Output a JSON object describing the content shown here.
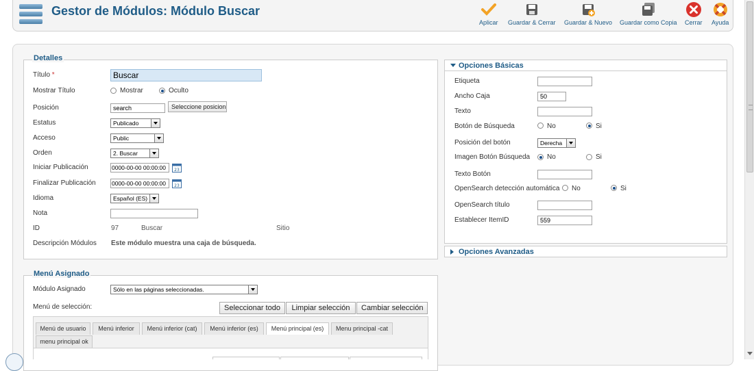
{
  "header": {
    "title": "Gestor de Módulos: Módulo Buscar",
    "toolbar": [
      {
        "label": "Aplicar",
        "icon": "checkmark-icon"
      },
      {
        "label": "Guardar & Cerrar",
        "icon": "save-icon"
      },
      {
        "label": "Guardar & Nuevo",
        "icon": "save-new-icon"
      },
      {
        "label": "Guardar como Copia",
        "icon": "save-copy-icon"
      },
      {
        "label": "Cerrar",
        "icon": "close-icon"
      },
      {
        "label": "Ayuda",
        "icon": "help-lifebuoy-icon"
      }
    ]
  },
  "details": {
    "legend": "Detalles",
    "title_label": "Título",
    "required_mark": "*",
    "title_value": "Buscar",
    "show_title_label": "Mostrar Título",
    "show_option": "Mostrar",
    "hide_option": "Oculto",
    "show_title_selected": "Oculto",
    "position_label": "Posición",
    "position_value": "search",
    "select_position_button": "Seleccione posicion",
    "status_label": "Estatus",
    "status_value": "Publicado",
    "access_label": "Acceso",
    "access_value": "Public",
    "order_label": "Orden",
    "order_value": "2. Buscar",
    "start_label": "Iniciar Publicación",
    "start_value": "0000-00-00 00:00:00",
    "finish_label": "Finalizar Publicación",
    "finish_value": "0000-00-00 00:00:00",
    "language_label": "Idioma",
    "language_value": "Español (ES)",
    "note_label": "Nota",
    "note_value": "",
    "id_label": "ID",
    "id_value": "97",
    "module_name": "Buscar",
    "site": "Sitio",
    "desc_label": "Descripción Módulos",
    "desc_value": "Este módulo muestra una caja de búsqueda."
  },
  "basic_options": {
    "title": "Opciones Básicas",
    "label_label": "Etiqueta",
    "label_value": "",
    "box_width_label": "Ancho Caja",
    "box_width_value": "50",
    "text_label": "Texto",
    "text_value": "",
    "search_button_label": "Botón de Búsqueda",
    "search_button_selected": "Si",
    "button_position_label": "Posición del botón",
    "button_position_value": "Derecha",
    "image_button_label": "Imagen Botón Búsqueda",
    "image_button_selected": "No",
    "button_text_label": "Texto Botón",
    "button_text_value": "",
    "opensearch_autodetect_label": "OpenSearch detección automática",
    "opensearch_autodetect_selected": "Si",
    "opensearch_title_label": "OpenSearch título",
    "opensearch_title_value": "",
    "itemid_label": "Establecer ItemID",
    "itemid_value": "559",
    "no_option": "No",
    "yes_option": "Si"
  },
  "advanced_options": {
    "title": "Opciones Avanzadas"
  },
  "menu_assignment": {
    "legend": "Menú Asignado",
    "assigned_label": "Módulo Asignado",
    "assigned_value": "Sólo en las páginas seleccionadas.",
    "selection_label": "Menú de selección:",
    "buttons": [
      "Seleccionar todo",
      "Limpiar selección",
      "Cambiar selección"
    ],
    "tabs": [
      "Menú de usuario",
      "Menú inferior",
      "Menú inferior (cat)",
      "Menú inferior (es)",
      "Menú principal (es)",
      "Menu principal -cat",
      "menu principal ok"
    ],
    "active_tab": "Menú principal (es)"
  },
  "colors": {
    "accent": "#1f5c87",
    "title_input_bg": "#d8e8f6",
    "close_red": "#d9322c",
    "check_orange": "#f3a326"
  }
}
